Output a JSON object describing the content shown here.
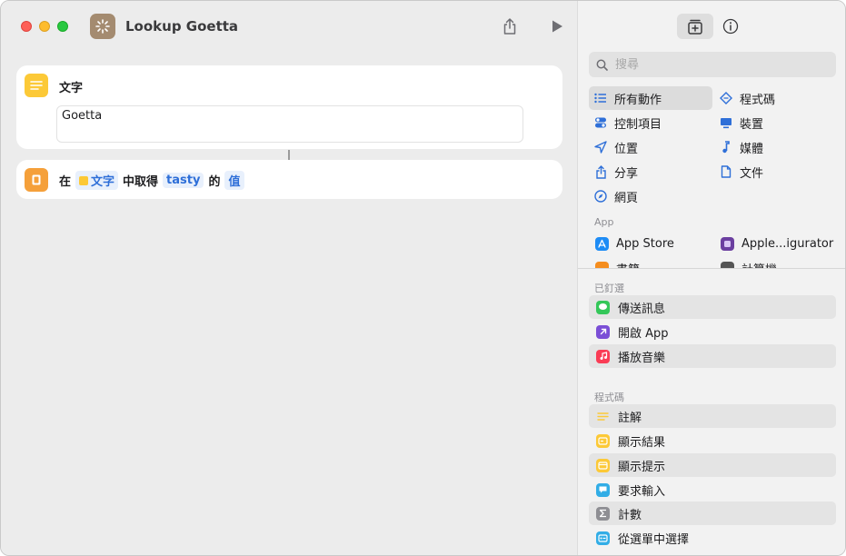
{
  "window": {
    "title": "Lookup Goetta"
  },
  "editor": {
    "text_action": {
      "title": "文字",
      "content": "Goetta"
    },
    "get_action": {
      "prefix": "在",
      "source_token": "文字",
      "middle": "中取得",
      "key_token": "tasty",
      "suffix": "的",
      "value_token": "值"
    }
  },
  "sidebar": {
    "search": {
      "placeholder": "搜尋",
      "value": ""
    },
    "categories": [
      {
        "label": "所有動作",
        "icon": "list-icon",
        "selected": true
      },
      {
        "label": "程式碼",
        "icon": "scripting-icon"
      },
      {
        "label": "控制項目",
        "icon": "toggle-icon"
      },
      {
        "label": "裝置",
        "icon": "display-icon"
      },
      {
        "label": "位置",
        "icon": "location-arrow-icon"
      },
      {
        "label": "媒體",
        "icon": "music-note-icon"
      },
      {
        "label": "分享",
        "icon": "share-icon"
      },
      {
        "label": "文件",
        "icon": "document-icon"
      },
      {
        "label": "網頁",
        "icon": "compass-icon"
      }
    ],
    "app_section": {
      "heading": "App",
      "items": [
        {
          "label": "App Store",
          "icon": "app-store-icon",
          "color": "#1e8cf5"
        },
        {
          "label": "Apple...igurator",
          "icon": "configurator-icon",
          "color": "#6b3fa0"
        },
        {
          "label": "書籍",
          "icon": "books-icon",
          "color": "#f58d1e"
        },
        {
          "label": "計算機",
          "icon": "calculator-icon",
          "color": "#555555"
        }
      ]
    },
    "pinned_section": {
      "heading": "已釘選",
      "items": [
        {
          "label": "傳送訊息",
          "icon": "messages-icon",
          "color": "#34c759"
        },
        {
          "label": "開啟 App",
          "icon": "open-app-icon",
          "color": "#7b4fd6"
        },
        {
          "label": "播放音樂",
          "icon": "music-icon",
          "color": "#fa3c55"
        }
      ]
    },
    "scripting_section": {
      "heading": "程式碼",
      "items": [
        {
          "label": "註解",
          "icon": "comment-icon",
          "color": "#fcc937"
        },
        {
          "label": "顯示結果",
          "icon": "show-result-icon",
          "color": "#fcc937"
        },
        {
          "label": "顯示提示",
          "icon": "show-alert-icon",
          "color": "#fcc937"
        },
        {
          "label": "要求輸入",
          "icon": "ask-input-icon",
          "color": "#32ade6"
        },
        {
          "label": "計數",
          "icon": "sigma-icon",
          "color": "#8e8e93"
        },
        {
          "label": "從選單中選擇",
          "icon": "choose-menu-icon",
          "color": "#32ade6"
        }
      ]
    }
  }
}
